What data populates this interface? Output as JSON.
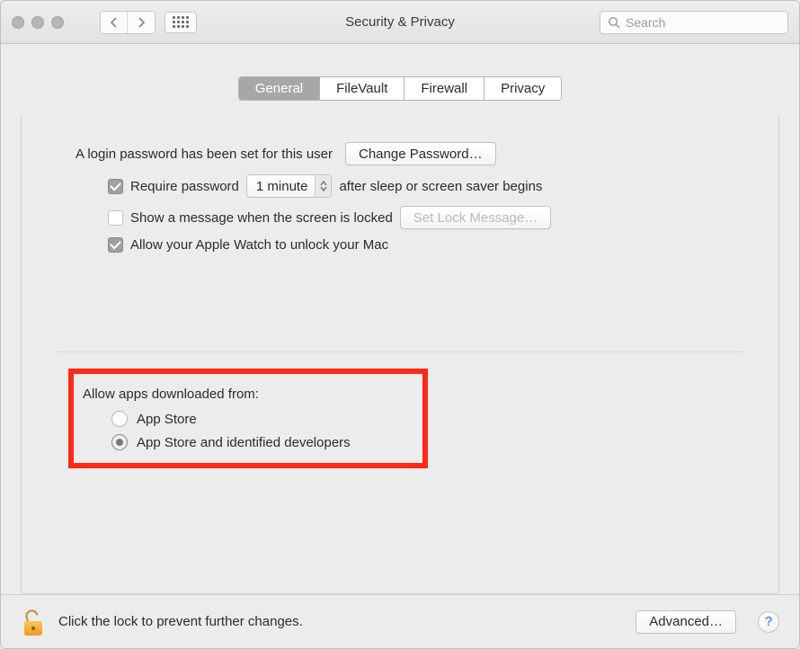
{
  "window": {
    "title": "Security & Privacy"
  },
  "toolbar": {
    "search_placeholder": "Search"
  },
  "tabs": {
    "general": "General",
    "filevault": "FileVault",
    "firewall": "Firewall",
    "privacy": "Privacy",
    "active": "general"
  },
  "login": {
    "status_text": "A login password has been set for this user",
    "change_password_label": "Change Password…"
  },
  "options": {
    "require_password": {
      "checked": true,
      "label_before": "Require password",
      "delay_value": "1 minute",
      "label_after": "after sleep or screen saver begins"
    },
    "show_message": {
      "checked": false,
      "label": "Show a message when the screen is locked",
      "button_label": "Set Lock Message…",
      "button_enabled": false
    },
    "apple_watch": {
      "checked": true,
      "label": "Allow your Apple Watch to unlock your Mac"
    }
  },
  "gatekeeper": {
    "heading": "Allow apps downloaded from:",
    "options": [
      {
        "label": "App Store",
        "selected": false
      },
      {
        "label": "App Store and identified developers",
        "selected": true
      }
    ]
  },
  "footer": {
    "lock_text": "Click the lock to prevent further changes.",
    "advanced_label": "Advanced…",
    "help_label": "?"
  },
  "highlight": {
    "color": "#ff2a1a"
  }
}
